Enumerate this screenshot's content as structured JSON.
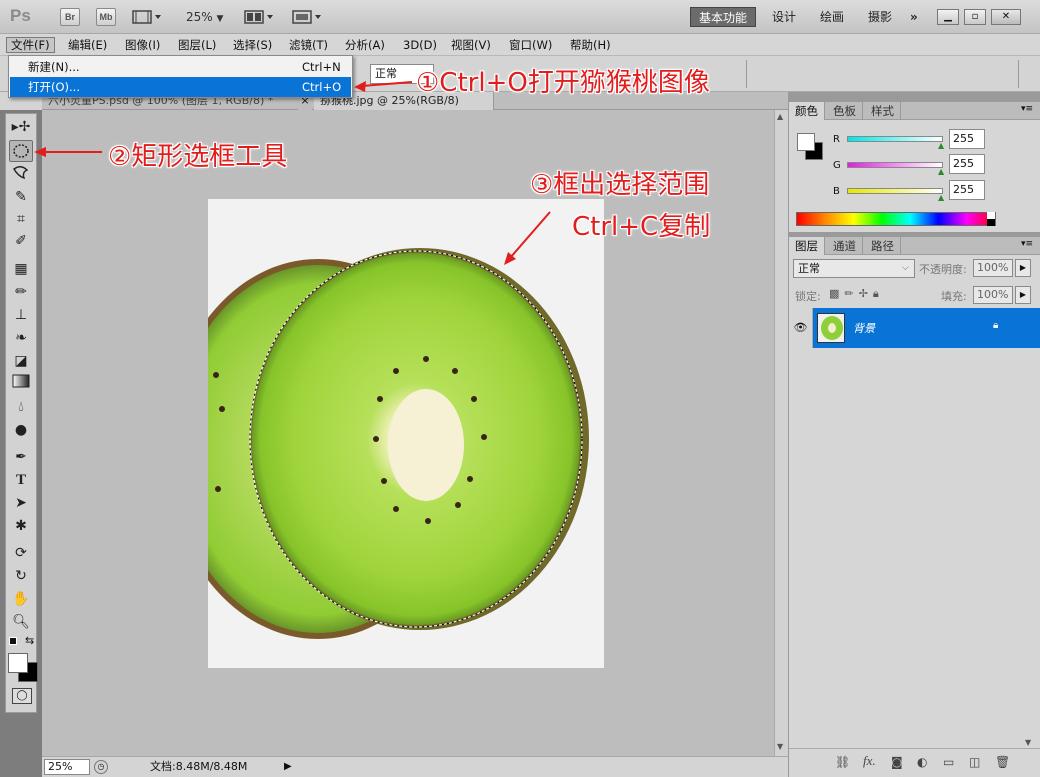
{
  "app": {
    "logo": "Ps",
    "bridge_btn": "Br",
    "minibridge_btn": "Mb",
    "zoom_value": "25%",
    "workspaces": [
      "基本功能",
      "设计",
      "绘画",
      "摄影"
    ],
    "more_workspaces": "»"
  },
  "menubar": [
    "文件(F)",
    "编辑(E)",
    "图像(I)",
    "图层(L)",
    "选择(S)",
    "滤镜(T)",
    "分析(A)",
    "3D(D)",
    "视图(V)",
    "窗口(W)",
    "帮助(H)"
  ],
  "file_menu": [
    {
      "label": "新建(N)...",
      "shortcut": "Ctrl+N"
    },
    {
      "label": "打开(O)...",
      "shortcut": "Ctrl+O"
    }
  ],
  "options_bar": {
    "mode_value": "正常"
  },
  "doc_tabs": [
    {
      "label": "六小灵童PS.psd @ 100% (图层 1, RGB/8) *"
    },
    {
      "label": "猕猴桃.jpg @ 25%(RGB/8)"
    }
  ],
  "annotations": {
    "step1": "①Ctrl+O打开猕猴桃图像",
    "step2": "②矩形选框工具",
    "step3_line1": "③框出选择范围",
    "step3_line2": "Ctrl+C复制"
  },
  "color_panel": {
    "tabs": [
      "颜色",
      "色板",
      "样式"
    ],
    "channels": [
      {
        "name": "R",
        "value": "255",
        "color": "#00e5e5"
      },
      {
        "name": "G",
        "value": "255",
        "color": "#e020e0"
      },
      {
        "name": "B",
        "value": "255",
        "color": "#e8e800"
      }
    ]
  },
  "layers_panel": {
    "tabs": [
      "图层",
      "通道",
      "路径"
    ],
    "blend_mode": "正常",
    "opacity_label": "不透明度:",
    "opacity_value": "100%",
    "lock_label": "锁定:",
    "fill_label": "填充:",
    "fill_value": "100%",
    "layers": [
      {
        "name": "背景",
        "visible": true,
        "locked": true,
        "selected": true
      }
    ]
  },
  "status": {
    "zoom": "25%",
    "doc_size": "文档:8.48M/8.48M"
  },
  "colors": {
    "accent": "#0a73d6",
    "annotation": "#e11d1d"
  }
}
